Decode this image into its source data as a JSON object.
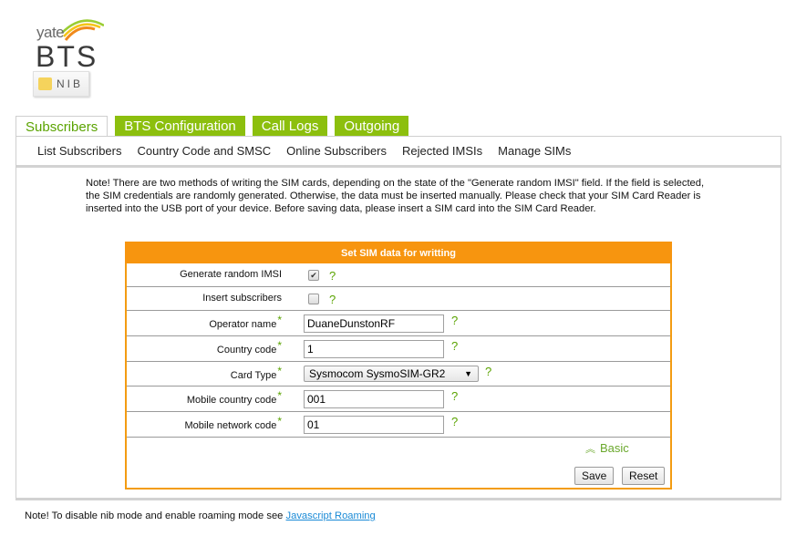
{
  "logo": {
    "top_text": "yate",
    "main_text": "BTS",
    "badge_text": "NIB"
  },
  "tabs": [
    {
      "label": "Subscribers",
      "active": true
    },
    {
      "label": "BTS Configuration",
      "active": false
    },
    {
      "label": "Call Logs",
      "active": false
    },
    {
      "label": "Outgoing",
      "active": false
    }
  ],
  "subnav": [
    {
      "label": "List Subscribers"
    },
    {
      "label": "Country Code and SMSC"
    },
    {
      "label": "Online Subscribers"
    },
    {
      "label": "Rejected IMSIs"
    },
    {
      "label": "Manage SIMs"
    }
  ],
  "note": "Note! There are two methods of writing the SIM cards, depending on the state of the \"Generate random IMSI\" field. If the field is selected, the SIM credentials are randomly generated. Otherwise, the data must be inserted manually. Please check that your SIM Card Reader is inserted into the USB port of your device. Before saving data, please insert a SIM card into the SIM Card Reader.",
  "form": {
    "title": "Set SIM data for writting",
    "help_symbol": "?",
    "required_symbol": "*",
    "fields": {
      "generate_random_imsi": {
        "label": "Generate random IMSI",
        "checked": true,
        "check_glyph": "✔"
      },
      "insert_subscribers": {
        "label": "Insert subscribers",
        "checked": false,
        "check_glyph": ""
      },
      "operator_name": {
        "label": "Operator name",
        "value": "DuaneDunstonRF"
      },
      "country_code": {
        "label": "Country code",
        "value": "1"
      },
      "card_type": {
        "label": "Card Type",
        "value": "Sysmocom SysmoSIM-GR2",
        "arrow": "▼"
      },
      "mobile_country_code": {
        "label": "Mobile country code",
        "value": "001"
      },
      "mobile_network_code": {
        "label": "Mobile network code",
        "value": "01"
      }
    },
    "basic_link": {
      "label": "Basic",
      "icon": "≈"
    },
    "buttons": {
      "save": "Save",
      "reset": "Reset"
    }
  },
  "footer": {
    "text": "Note! To disable nib mode and enable roaming mode see ",
    "link_label": "Javascript Roaming"
  },
  "colors": {
    "accent_green": "#8cbf0e",
    "text_green": "#5aa300",
    "form_orange": "#f7950f",
    "link_blue": "#1a8ad6"
  }
}
